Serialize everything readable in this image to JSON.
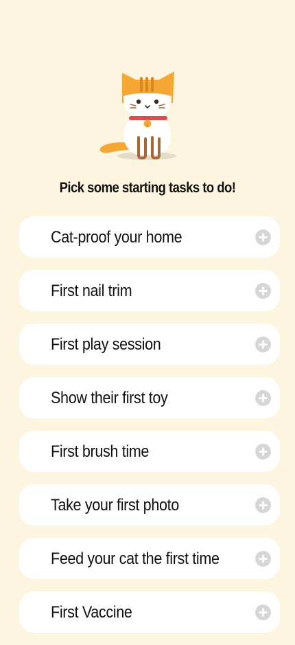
{
  "header": {
    "mascot_icon": "orange-cat-icon",
    "title": "Pick some starting tasks to do!"
  },
  "tasks": [
    {
      "label": "Cat-proof your home",
      "icon": "add-circle-icon"
    },
    {
      "label": "First nail trim",
      "icon": "add-circle-icon"
    },
    {
      "label": "First play session",
      "icon": "add-circle-icon"
    },
    {
      "label": "Show their first toy",
      "icon": "add-circle-icon"
    },
    {
      "label": "First brush time",
      "icon": "add-circle-icon"
    },
    {
      "label": "Take your first photo",
      "icon": "add-circle-icon"
    },
    {
      "label": "Feed your cat the first time",
      "icon": "add-circle-icon"
    },
    {
      "label": "First Vaccine",
      "icon": "add-circle-icon"
    }
  ],
  "colors": {
    "background": "#fdf5e0",
    "card": "#ffffff",
    "cat_orange": "#f4a733",
    "cat_stripe": "#d98a1f",
    "collar": "#e34a4a",
    "add_icon": "#d6d6d6",
    "text": "#111111"
  }
}
